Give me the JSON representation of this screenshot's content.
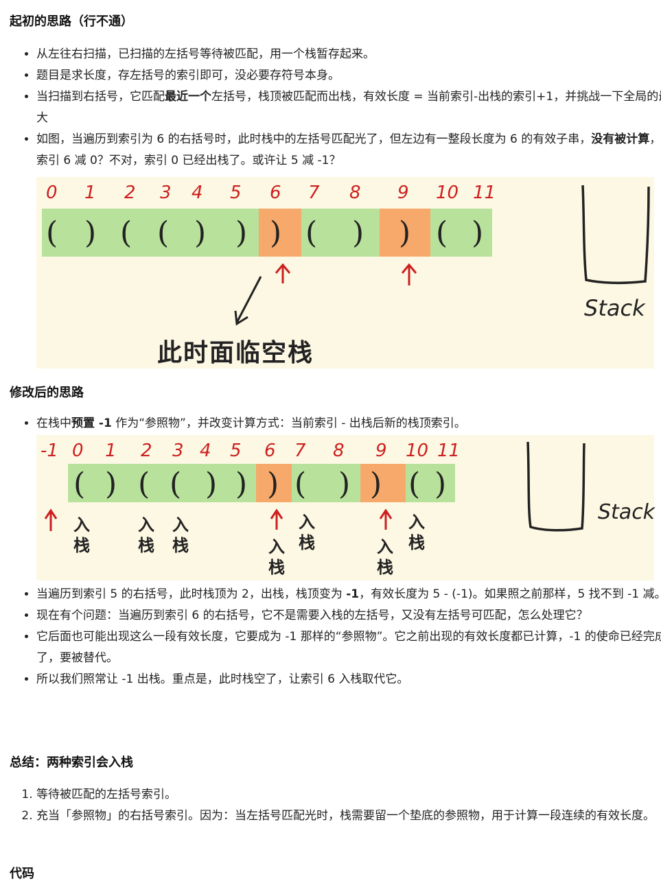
{
  "section1": {
    "heading": "起初的思路（行不通）",
    "bullets": [
      [
        "从左往右扫描，已扫描的左括号等待被匹配，用一个栈暂存起来。"
      ],
      [
        "题目是求长度，存左括号的索引即可，没必要存符号本身。"
      ],
      [
        "当扫描到右括号，它匹配",
        "最近一个",
        "左括号，栈顶被匹配而出栈，有效长度 = 当前索引-出栈的索引+1，并挑战一下全局的最大"
      ],
      [
        "如图，当遍历到索引为 6 的右括号时，此时栈中的左括号匹配光了，但左边有一整段长度为 6 的有效子串，",
        "没有被计算",
        "，让索引 6 减 0？不对，索引 0 已经出栈了。或许让 5 减 -1？"
      ]
    ]
  },
  "figure1": {
    "indices": [
      "0",
      "1",
      "2",
      "3",
      "4",
      "5",
      "6",
      "7",
      "8",
      "9",
      "10",
      "11"
    ],
    "parens": [
      "(",
      ")",
      "(",
      "(",
      ")",
      ")",
      ")",
      "(",
      ")",
      ")",
      "(",
      ")"
    ],
    "cell_states": [
      "g",
      "g",
      "g",
      "g",
      "g",
      "g",
      "o",
      "g",
      "g",
      "o",
      "g",
      "g"
    ],
    "stack_label": "Stack",
    "caption": "此时面临空栈"
  },
  "section2": {
    "heading": "修改后的思路",
    "bullet1": [
      "在栈中",
      "预置 -1",
      " 作为“参照物”，并改变计算方式：当前索引 - 出栈后新的栈顶索引。"
    ],
    "bullets": [
      [
        "当遍历到索引 5 的右括号，此时栈顶为 2，出栈，栈顶变为 ",
        "-1",
        "，有效长度为 5 - (-1)。如果照之前那样，5 找不到 -1 减。"
      ],
      [
        "现在有个问题：当遍历到索引 6 的右括号，它不是需要入栈的左括号，又没有左括号可匹配，怎么处理它？"
      ],
      [
        "它后面也可能出现这么一段有效长度，它要成为 -1 那样的“参照物”。它之前出现的有效长度都已计算，-1 的使命已经完成了，要被替代。"
      ],
      [
        "所以我们照常让 -1 出栈。重点是，此时栈空了，让索引 6 入栈取代它。"
      ]
    ]
  },
  "figure2": {
    "indices": [
      "-1",
      "0",
      "1",
      "2",
      "3",
      "4",
      "5",
      "6",
      "7",
      "8",
      "9",
      "10",
      "11"
    ],
    "parens": [
      "(",
      ")",
      "(",
      "(",
      ")",
      ")",
      ")",
      "(",
      ")",
      ")",
      "(",
      ")"
    ],
    "cell_states": [
      "g",
      "g",
      "g",
      "g",
      "g",
      "g",
      "o",
      "g",
      "g",
      "o",
      "g",
      "g"
    ],
    "push_label": "入栈",
    "stack_label": "Stack"
  },
  "section3": {
    "heading": "总结：两种索引会入栈",
    "items": [
      "等待被匹配的左括号索引。",
      "充当「参照物」的右括号索引。因为：当左括号匹配光时，栈需要留一个垫底的参照物，用于计算一段连续的有效长度。"
    ]
  },
  "section4": {
    "heading": "代码"
  },
  "colors": {
    "green": "#b8e29c",
    "orange": "#f6a96a",
    "figure_bg": "#fdf8e4",
    "index_red": "#cc1f1f"
  }
}
